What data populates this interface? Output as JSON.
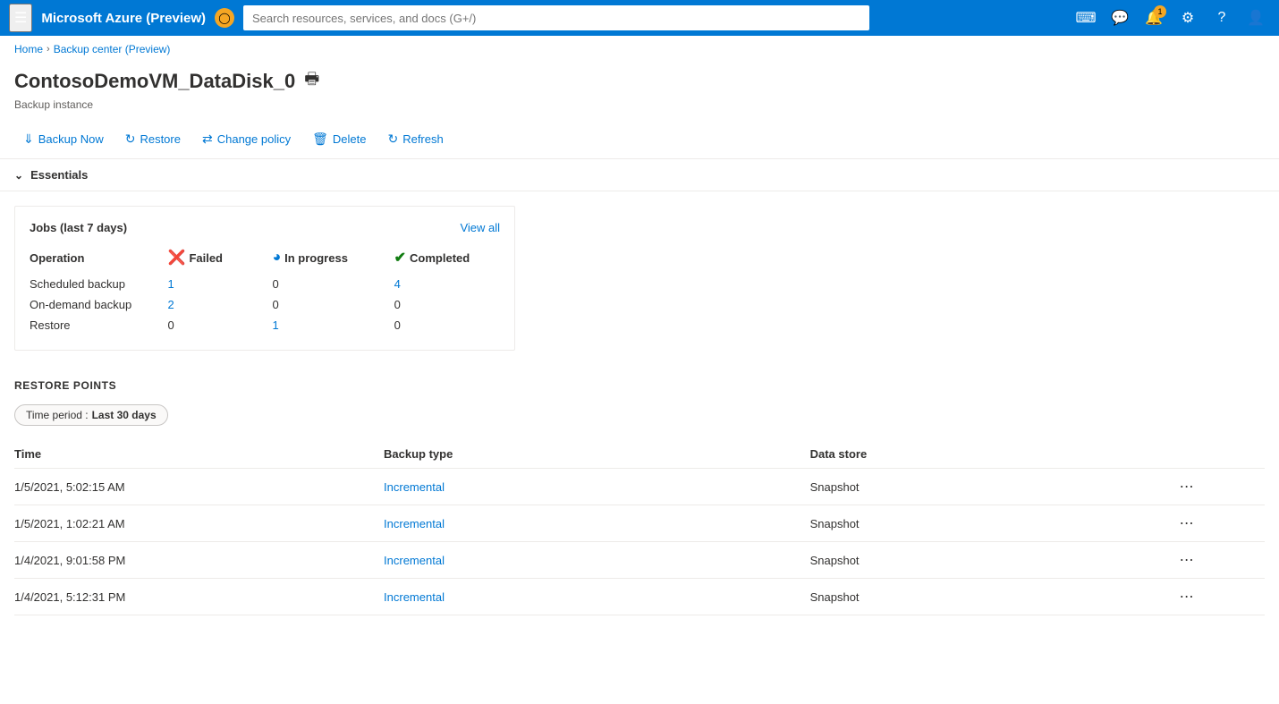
{
  "topbar": {
    "title": "Microsoft Azure (Preview)",
    "search_placeholder": "Search resources, services, and docs (G+/)",
    "badge_text": "1",
    "notification_count": "1"
  },
  "breadcrumb": {
    "items": [
      "Home",
      "Backup center (Preview)"
    ]
  },
  "page": {
    "title": "ContosoDemoVM_DataDisk_0",
    "subtitle": "Backup instance"
  },
  "toolbar": {
    "backup_now": "Backup Now",
    "restore": "Restore",
    "change_policy": "Change policy",
    "delete": "Delete",
    "refresh": "Refresh"
  },
  "essentials": {
    "label": "Essentials"
  },
  "jobs_card": {
    "title": "Jobs (last 7 days)",
    "view_all": "View all",
    "columns": {
      "operation": "Operation",
      "failed": "Failed",
      "in_progress": "In progress",
      "completed": "Completed"
    },
    "rows": [
      {
        "operation": "Scheduled backup",
        "failed": "1",
        "failed_link": true,
        "in_progress": "0",
        "in_progress_link": false,
        "completed": "4",
        "completed_link": true
      },
      {
        "operation": "On-demand backup",
        "failed": "2",
        "failed_link": true,
        "in_progress": "0",
        "in_progress_link": false,
        "completed": "0",
        "completed_link": false
      },
      {
        "operation": "Restore",
        "failed": "0",
        "failed_link": false,
        "in_progress": "1",
        "in_progress_link": true,
        "completed": "0",
        "completed_link": false
      }
    ]
  },
  "restore_points": {
    "section_title": "RESTORE POINTS",
    "time_period_label": "Time period :",
    "time_period_value": "Last 30 days",
    "columns": {
      "time": "Time",
      "backup_type": "Backup type",
      "data_store": "Data store"
    },
    "rows": [
      {
        "time": "1/5/2021, 5:02:15 AM",
        "backup_type": "Incremental",
        "data_store": "Snapshot"
      },
      {
        "time": "1/5/2021, 1:02:21 AM",
        "backup_type": "Incremental",
        "data_store": "Snapshot"
      },
      {
        "time": "1/4/2021, 9:01:58 PM",
        "backup_type": "Incremental",
        "data_store": "Snapshot"
      },
      {
        "time": "1/4/2021, 5:12:31 PM",
        "backup_type": "Incremental",
        "data_store": "Snapshot"
      }
    ]
  }
}
